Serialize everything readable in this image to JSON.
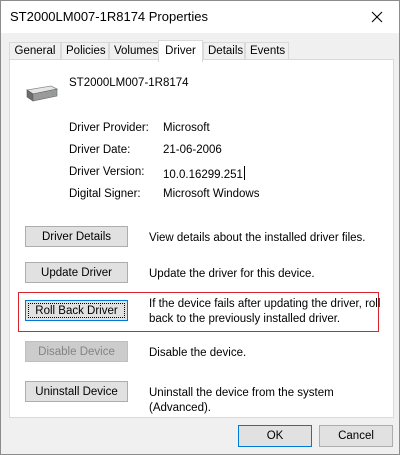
{
  "window": {
    "title": "ST2000LM007-1R8174 Properties",
    "close_icon": "close-icon"
  },
  "tabs": [
    {
      "label": "General",
      "active": false
    },
    {
      "label": "Policies",
      "active": false
    },
    {
      "label": "Volumes",
      "active": false
    },
    {
      "label": "Driver",
      "active": true
    },
    {
      "label": "Details",
      "active": false
    },
    {
      "label": "Events",
      "active": false
    }
  ],
  "device": {
    "icon": "disk-drive-icon",
    "name": "ST2000LM007-1R8174"
  },
  "properties": [
    {
      "label": "Driver Provider:",
      "value": "Microsoft"
    },
    {
      "label": "Driver Date:",
      "value": "21-06-2006"
    },
    {
      "label": "Driver Version:",
      "value": "10.0.16299.251"
    },
    {
      "label": "Digital Signer:",
      "value": "Microsoft Windows"
    }
  ],
  "actions": [
    {
      "label": "Driver Details",
      "description": "View details about the installed driver files.",
      "enabled": true
    },
    {
      "label": "Update Driver",
      "description": "Update the driver for this device.",
      "enabled": true
    },
    {
      "label": "Roll Back Driver",
      "description": "If the device fails after updating the driver, roll back to the previously installed driver.",
      "enabled": true,
      "focused": true,
      "highlighted": true
    },
    {
      "label": "Disable Device",
      "description": "Disable the device.",
      "enabled": false
    },
    {
      "label": "Uninstall Device",
      "description": "Uninstall the device from the system (Advanced).",
      "enabled": true
    }
  ],
  "footer": {
    "ok_label": "OK",
    "cancel_label": "Cancel"
  },
  "colors": {
    "highlight_border": "#d9232d",
    "focus_border": "#0078d7"
  }
}
